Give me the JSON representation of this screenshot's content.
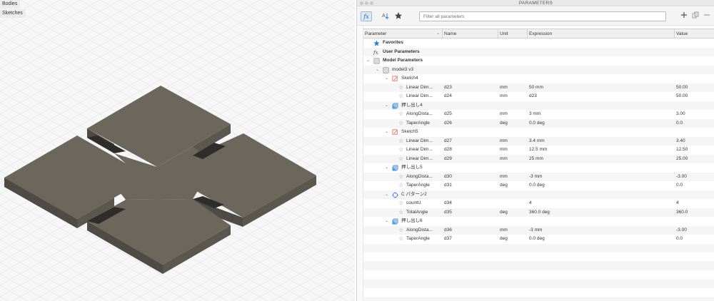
{
  "browser": {
    "bodies": "Bodies",
    "sketches": "Sketches"
  },
  "window": {
    "title": "PARAMETERS"
  },
  "toolbar": {
    "fx_icon": "fx-icon",
    "search_placeholder": "Filter all parameters",
    "add_icon": "plus-icon",
    "copy_icon": "copy-icon",
    "delete_icon": "minus-icon"
  },
  "columns": {
    "parameter": "Parameter",
    "name": "Name",
    "unit": "Unit",
    "expression": "Expression",
    "value": "Value"
  },
  "rows": [
    {
      "kind": "group",
      "icon": "star-icon",
      "label": "Favorites",
      "indent": 1
    },
    {
      "kind": "group",
      "icon": "fx-icon",
      "label": "User Parameters",
      "indent": 1
    },
    {
      "kind": "group",
      "icon": "component-icon",
      "label": "Model Parameters",
      "indent": 1,
      "chev": "⌄"
    },
    {
      "kind": "node",
      "icon": "component-icon",
      "label": "model3 v3",
      "indent": 2,
      "chev": "⌄"
    },
    {
      "kind": "node",
      "icon": "sketch-icon",
      "label": "Sketch4",
      "indent": 3,
      "chev": "⌄"
    },
    {
      "kind": "param",
      "label": "Linear Dim...",
      "name": "d23",
      "unit": "mm",
      "expr": "50 mm",
      "value": "50.00",
      "indent": 4
    },
    {
      "kind": "param",
      "label": "Linear Dim...",
      "name": "d24",
      "unit": "mm",
      "expr": "d23",
      "value": "50.00",
      "indent": 4
    },
    {
      "kind": "node",
      "icon": "extrude-icon",
      "label": "押し出し4",
      "indent": 3,
      "chev": "⌄"
    },
    {
      "kind": "param",
      "label": "AlongDista...",
      "name": "d25",
      "unit": "mm",
      "expr": "3 mm",
      "value": "3.00",
      "indent": 4
    },
    {
      "kind": "param",
      "label": "TaperAngle",
      "name": "d26",
      "unit": "deg",
      "expr": "0.0 deg",
      "value": "0.0",
      "indent": 4
    },
    {
      "kind": "node",
      "icon": "sketch-icon",
      "label": "Sketch5",
      "indent": 3,
      "chev": "⌄"
    },
    {
      "kind": "param",
      "label": "Linear Dim...",
      "name": "d27",
      "unit": "mm",
      "expr": "3.4 mm",
      "value": "3.40",
      "indent": 4
    },
    {
      "kind": "param",
      "label": "Linear Dim...",
      "name": "d28",
      "unit": "mm",
      "expr": "12.5 mm",
      "value": "12.50",
      "indent": 4
    },
    {
      "kind": "param",
      "label": "Linear Dim...",
      "name": "d29",
      "unit": "mm",
      "expr": "25 mm",
      "value": "25.00",
      "indent": 4
    },
    {
      "kind": "node",
      "icon": "extrude-icon",
      "label": "押し出し5",
      "indent": 3,
      "chev": "⌄"
    },
    {
      "kind": "param",
      "label": "AlongDista...",
      "name": "d30",
      "unit": "mm",
      "expr": "-3 mm",
      "value": "-3.00",
      "indent": 4
    },
    {
      "kind": "param",
      "label": "TaperAngle",
      "name": "d31",
      "unit": "deg",
      "expr": "0.0 deg",
      "value": "0.0",
      "indent": 4
    },
    {
      "kind": "node",
      "icon": "pattern-icon",
      "label": "C パターン2",
      "indent": 3,
      "chev": "⌄"
    },
    {
      "kind": "param",
      "label": "countU",
      "name": "d34",
      "unit": "",
      "expr": "4",
      "value": "4",
      "indent": 4
    },
    {
      "kind": "param",
      "label": "TotalAngle",
      "name": "d35",
      "unit": "deg",
      "expr": "360.0 deg",
      "value": "360.0",
      "indent": 4
    },
    {
      "kind": "node",
      "icon": "extrude-icon",
      "label": "押し出し6",
      "indent": 3,
      "chev": "⌄"
    },
    {
      "kind": "param",
      "label": "AlongDista...",
      "name": "d36",
      "unit": "mm",
      "expr": "-3 mm",
      "value": "-3.00",
      "indent": 4
    },
    {
      "kind": "param",
      "label": "TaperAngle",
      "name": "d37",
      "unit": "deg",
      "expr": "0.0 deg",
      "value": "0.0",
      "indent": 4
    }
  ],
  "colors": {
    "accent": "#2c7be5",
    "model_face": "#6b675d",
    "model_side": "#4e4b44",
    "grid": "#e2e2e2"
  }
}
